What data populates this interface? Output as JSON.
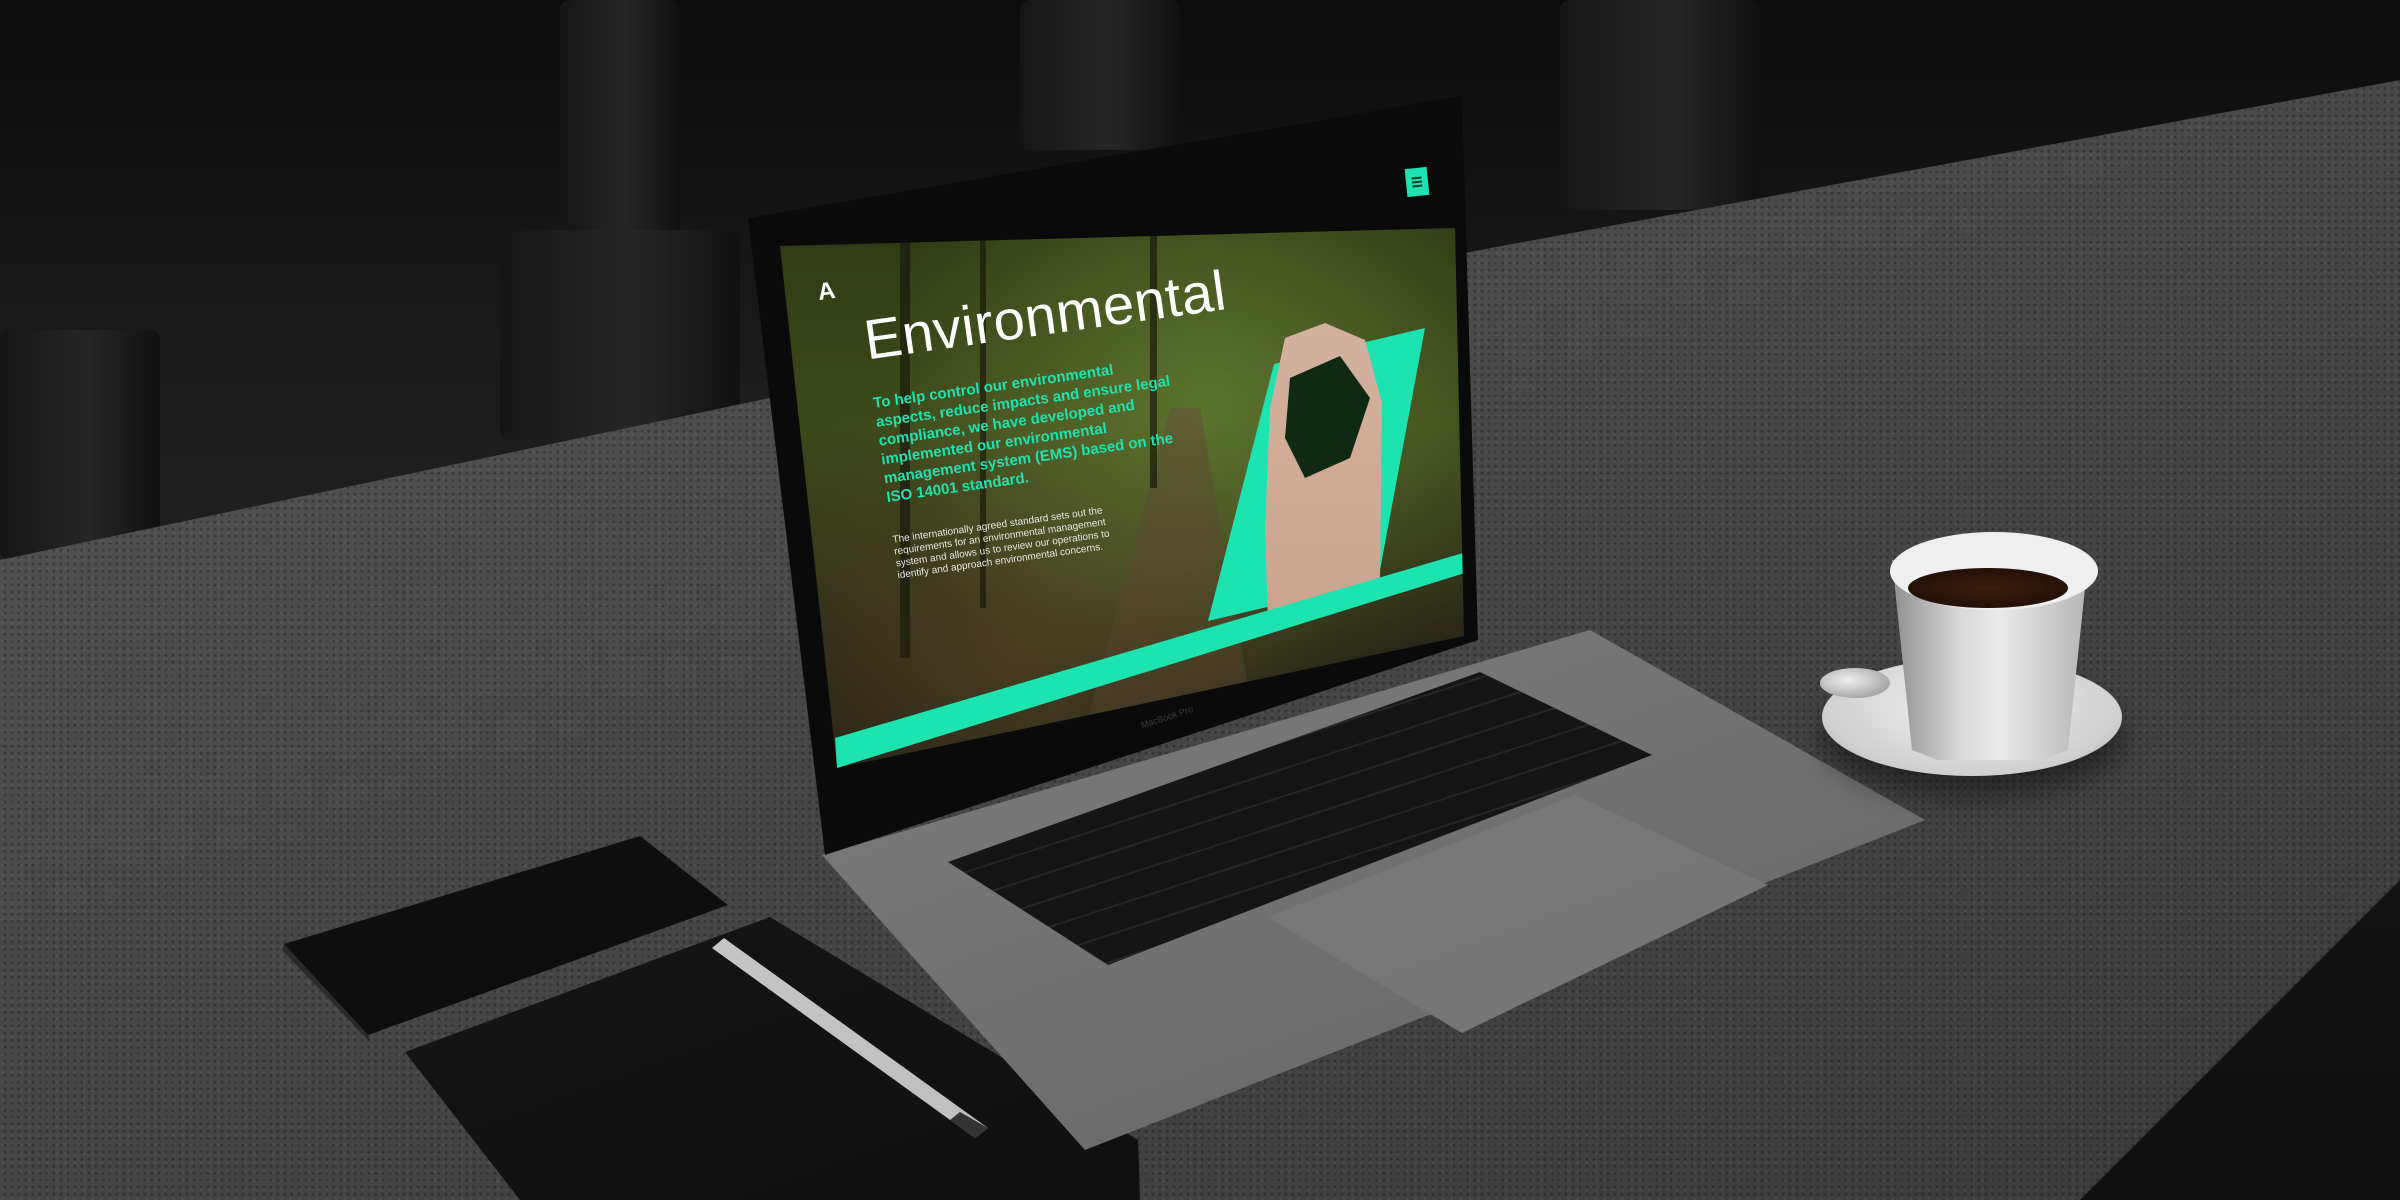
{
  "website": {
    "logo_mark": "A",
    "menu_icon": "hamburger-menu-icon",
    "title": "Environmental",
    "lead_text": "To help control our environmental aspects, reduce impacts and ensure legal compliance, we have developed and implemented our environmental management system (EMS) based on the ISO 14001 standard.",
    "body_text": "The internationally agreed standard sets out the requirements for an environmental management system and allows us to review our operations to identify and approach environmental concerns.",
    "accent_color": "#1de3b0"
  },
  "laptop": {
    "bezel_label": "MacBook Pro"
  }
}
